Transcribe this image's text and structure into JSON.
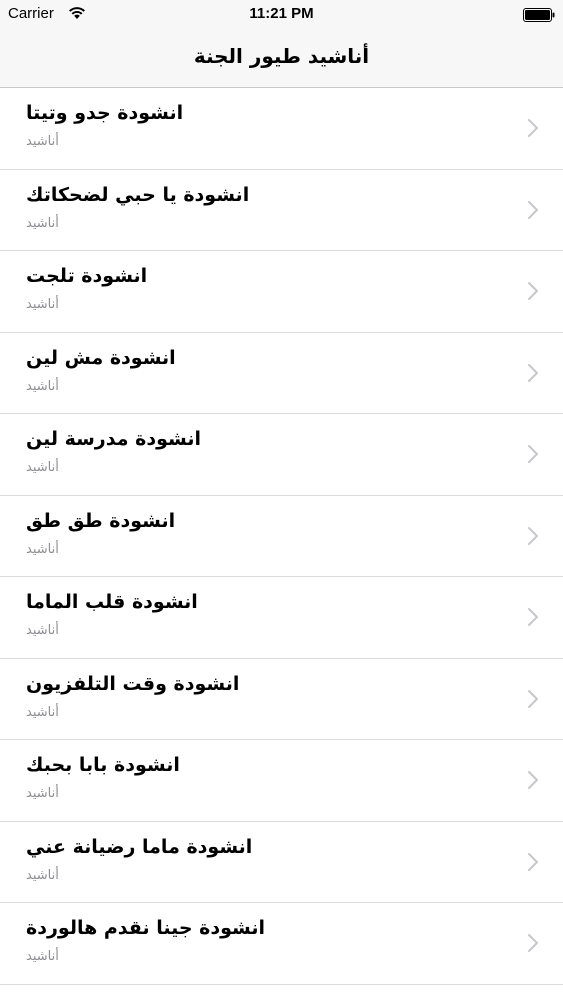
{
  "status_bar": {
    "carrier": "Carrier",
    "time": "11:21 PM",
    "wifi_icon": "wifi-icon",
    "battery_icon": "battery-icon"
  },
  "nav": {
    "title": "أناشيد طيور الجنة"
  },
  "list": {
    "items": [
      {
        "title": "انشودة جدو وتيتا",
        "subtitle": "أناشيد"
      },
      {
        "title": "انشودة يا حبي لضحكاتك",
        "subtitle": "أناشيد"
      },
      {
        "title": "انشودة تلجت",
        "subtitle": "أناشيد"
      },
      {
        "title": "انشودة مش لين",
        "subtitle": "أناشيد"
      },
      {
        "title": "انشودة مدرسة لين",
        "subtitle": "أناشيد"
      },
      {
        "title": "انشودة طق طق",
        "subtitle": "أناشيد"
      },
      {
        "title": "انشودة قلب الماما",
        "subtitle": "أناشيد"
      },
      {
        "title": "انشودة وقت التلفزيون",
        "subtitle": "أناشيد"
      },
      {
        "title": "انشودة بابا بحبك",
        "subtitle": "أناشيد"
      },
      {
        "title": "انشودة ماما رضيانة عني",
        "subtitle": "أناشيد"
      },
      {
        "title": "انشودة جينا نقدم هالوردة",
        "subtitle": "أناشيد"
      }
    ],
    "accessory_icon": "chevron-right-icon"
  },
  "colors": {
    "bar_background": "#f7f7f8",
    "separator": "#dcdcdf",
    "subtitle": "#8e8e93",
    "chevron": "#c7c7cc"
  }
}
